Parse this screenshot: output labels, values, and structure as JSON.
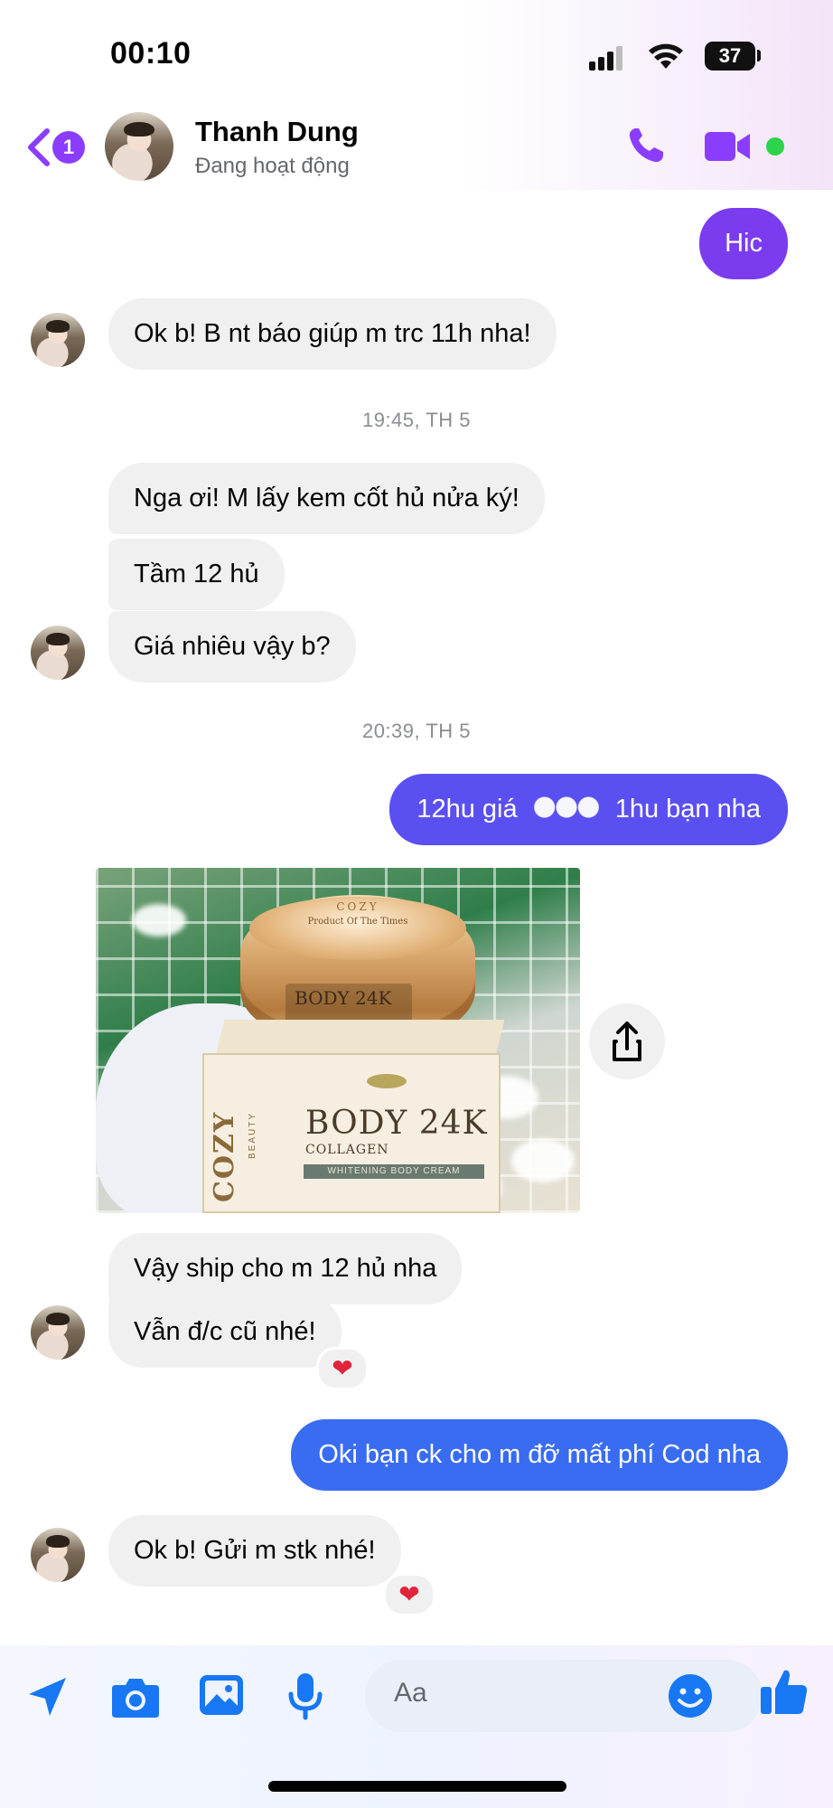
{
  "status_bar": {
    "time": "00:10",
    "battery": "37"
  },
  "header": {
    "back_badge": "1",
    "contact_name": "Thanh Dung",
    "contact_status": "Đang hoạt động"
  },
  "colors": {
    "accent": "#8b3dff",
    "bubble_violet": "#7b3cf0",
    "bubble_blue": "#3a6cf2",
    "bubble_in": "#f0f0f0",
    "heart": "#e0243a"
  },
  "messages": {
    "m1": "Hic",
    "m2": "Ok b! B nt báo giúp m trc 11h nha!",
    "ts1": "19:45, TH 5",
    "m3": "Nga ơi! M lấy kem cốt hủ nửa ký!",
    "m4": "Tầm 12 hủ",
    "m5": "Giá nhiêu vậy b?",
    "ts2": "20:39, TH 5",
    "m6_before": "12hu giá",
    "m6_after": "1hu bạn nha",
    "photo_text": {
      "lid_brand": "COZY",
      "lid_line": "Product Of The Times",
      "box_brand": "COZY",
      "box_sub": "BEAUTY",
      "box_title": "BODY 24K",
      "box_collagen": "COLLAGEN",
      "box_band": "WHITENING BODY CREAM"
    },
    "m7": "Vậy ship cho m 12 hủ nha",
    "m8": "Vẫn đ/c cũ nhé!",
    "m8_reaction": "❤",
    "m9": "Oki bạn ck cho m đỡ mất phí Cod nha",
    "m10": "Ok b! Gửi m stk nhé!",
    "m10_reaction": "❤"
  },
  "composer": {
    "placeholder": "Aa"
  },
  "icons": [
    "back-chevron-icon",
    "phone-icon",
    "video-camera-icon",
    "share-icon",
    "location-arrow-icon",
    "camera-icon",
    "gallery-icon",
    "microphone-icon",
    "emoji-icon",
    "like-thumb-icon"
  ]
}
